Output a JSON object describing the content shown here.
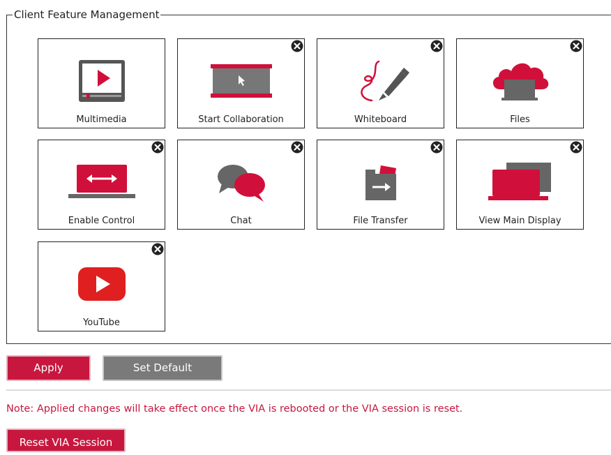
{
  "group_title": "Client Feature Management",
  "tiles": [
    {
      "label": "Multimedia",
      "icon": "multimedia-icon",
      "removable": false
    },
    {
      "label": "Start Collaboration",
      "icon": "collaboration-icon",
      "removable": true
    },
    {
      "label": "Whiteboard",
      "icon": "whiteboard-pen-icon",
      "removable": true
    },
    {
      "label": "Files",
      "icon": "cloud-files-icon",
      "removable": true
    },
    {
      "label": "Enable Control",
      "icon": "enable-control-icon",
      "removable": true
    },
    {
      "label": "Chat",
      "icon": "chat-bubbles-icon",
      "removable": true
    },
    {
      "label": "File Transfer",
      "icon": "file-transfer-icon",
      "removable": true
    },
    {
      "label": "View Main Display",
      "icon": "main-display-icon",
      "removable": true
    },
    {
      "label": "YouTube",
      "icon": "youtube-icon",
      "removable": true
    }
  ],
  "buttons": {
    "apply": "Apply",
    "set_default": "Set Default",
    "reset_session": "Reset VIA Session"
  },
  "note": "Note: Applied changes will take effect once the VIA is rebooted or the VIA session is reset.",
  "colors": {
    "accent": "#c8173e",
    "gray_button": "#7a7a7a",
    "icon_dark": "#4a4a4a",
    "icon_red": "#d0103a"
  }
}
